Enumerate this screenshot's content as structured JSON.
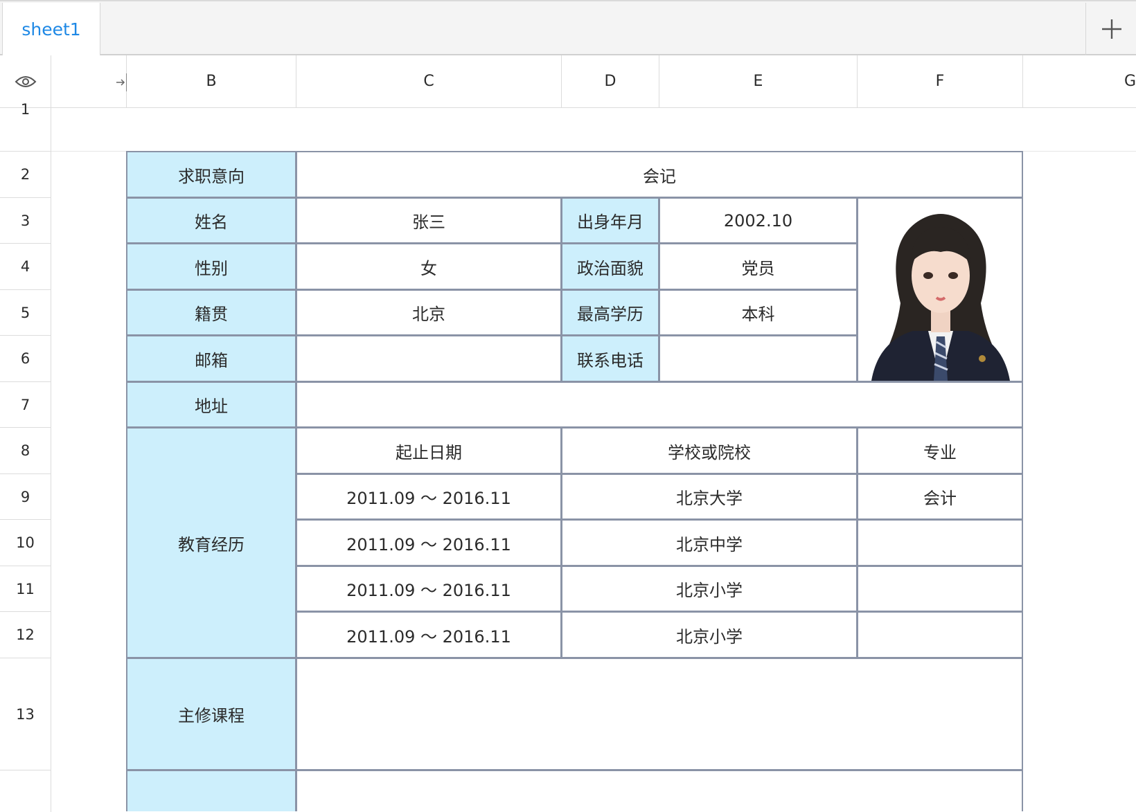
{
  "tabs": {
    "active": "sheet1"
  },
  "columns": [
    "B",
    "C",
    "D",
    "E",
    "F",
    "G"
  ],
  "rows": [
    "1",
    "2",
    "3",
    "4",
    "5",
    "6",
    "7",
    "8",
    "9",
    "10",
    "11",
    "12",
    "13"
  ],
  "resume": {
    "job_intent_label": "求职意向",
    "job_intent_value": "会记",
    "name_label": "姓名",
    "name_value": "张三",
    "birth_label": "出身年月",
    "birth_value": "2002.10",
    "gender_label": "性别",
    "gender_value": "女",
    "politics_label": "政治面貌",
    "politics_value": "党员",
    "origin_label": "籍贯",
    "origin_value": "北京",
    "degree_label": "最高学历",
    "degree_value": "本科",
    "email_label": "邮箱",
    "phone_label": "联系电话",
    "address_label": "地址",
    "education_label": "教育经历",
    "edu_headers": [
      "起止日期",
      "学校或院校",
      "专业"
    ],
    "education": [
      {
        "dates": "2011.09 ～ 2016.11",
        "school": "北京大学",
        "major": "会计"
      },
      {
        "dates": "2011.09 ～ 2016.11",
        "school": "北京中学",
        "major": ""
      },
      {
        "dates": "2011.09 ～ 2016.11",
        "school": "北京小学",
        "major": ""
      },
      {
        "dates": "2011.09 ～ 2016.11",
        "school": "北京小学",
        "major": ""
      }
    ],
    "courses_label": "主修课程"
  },
  "colors": {
    "label_bg": "#cdeffc",
    "border": "#8a93a6",
    "tab_text": "#1e88e5"
  }
}
